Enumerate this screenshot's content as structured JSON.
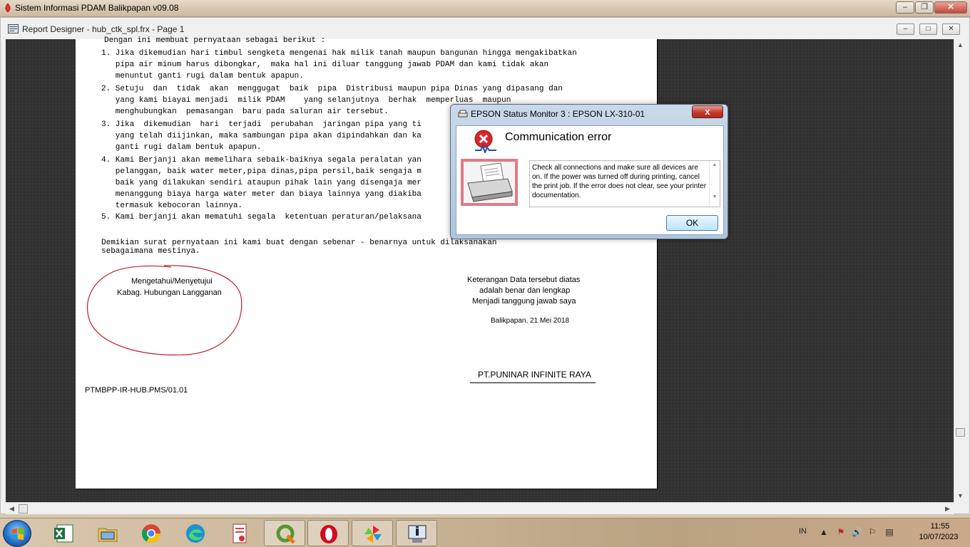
{
  "app": {
    "title": "Sistem Informasi PDAM Balikpapan v09.08"
  },
  "mdi": {
    "title": "Report Designer - hub_ctk_spl.frx - Page 1"
  },
  "report": {
    "lines": [
      "Dengan ini membuat pernyataan sebagai berikut :",
      "1. Jika dikemudian hari timbul sengketa mengenai hak milik tanah maupun bangunan hingga mengakibatkan",
      "   pipa air minum harus dibongkar,  maka hal ini diluar tanggung jawab PDAM dan kami tidak akan",
      "   menuntut ganti rugi dalam bentuk apapun.",
      "2. Setuju  dan  tidak  akan  menggugat  baik  pipa  Distribusi maupun pipa Dinas yang dipasang dan",
      "   yang kami biayai menjadi  milik PDAM    yang selanjutnya  berhak  memperluas  maupun",
      "   menghubungkan  pemasangan  baru pada saluran air tersebut.",
      "3. Jika  dikemudian  hari  terjadi  perubahan  jaringan pipa yang ti",
      "   yang telah diijinkan, maka sambungan pipa akan dipindahkan dan ka",
      "   ganti rugi dalam bentuk apapun.",
      "4. Kami Berjanji akan memelihara sebaik-baiknya segala peralatan yan",
      "   pelanggan, baik water meter,pipa dinas,pipa persil,baik sengaja m",
      "   baik yang dilakukan sendiri ataupun pihak lain yang disengaja mer",
      "   menanggung biaya harga water meter dan biaya lainnya yang diakiba",
      "   termasuk kebocoran lainnya.",
      "5. Kami berjanji akan mematuhi segala  ketentuan peraturan/pelaksana",
      "Demikian surat pernyataan ini kami buat dengan sebenar - benarnya untuk dilaksanakan",
      "sebagaimana mestinya."
    ],
    "left_sign": [
      "Mengetahui/Menyetujui",
      "Kabag. Hubungan Langganan"
    ],
    "right_note": [
      "Keterangan Data tersebut diatas",
      "adalah benar dan lengkap",
      "Menjadi tanggung jawab saya"
    ],
    "place_date": "Balikpapan, 21 Mei 2018",
    "company": "PT.PUNINAR INFINITE RAYA",
    "doc_code": "PTMBPP-IR-HUB.PMS/01.01"
  },
  "dialog": {
    "title": "EPSON Status Monitor 3 : EPSON LX-310-01",
    "close_label": "x",
    "heading": "Communication error",
    "message": "Check all connections and make sure all devices are on. If the power was turned off during printing, cancel the print job. If the error does not clear, see your printer documentation.",
    "ok_label": "OK"
  },
  "taskbar": {
    "apps": [
      {
        "icon": "excel-icon"
      },
      {
        "icon": "file-explorer-icon"
      },
      {
        "icon": "chrome-icon"
      },
      {
        "icon": "edge-icon"
      },
      {
        "icon": "document-icon"
      },
      {
        "icon": "qgis-icon"
      },
      {
        "icon": "opera-icon"
      },
      {
        "icon": "pinwheel-app-icon"
      },
      {
        "icon": "info-app-icon"
      }
    ],
    "language": "IN",
    "time": "11:55",
    "date": "10/07/2023"
  },
  "colors": {
    "dialog_close": "#c4382b",
    "signature_circle": "#c0202a",
    "ok_border": "#3c7fb1"
  }
}
